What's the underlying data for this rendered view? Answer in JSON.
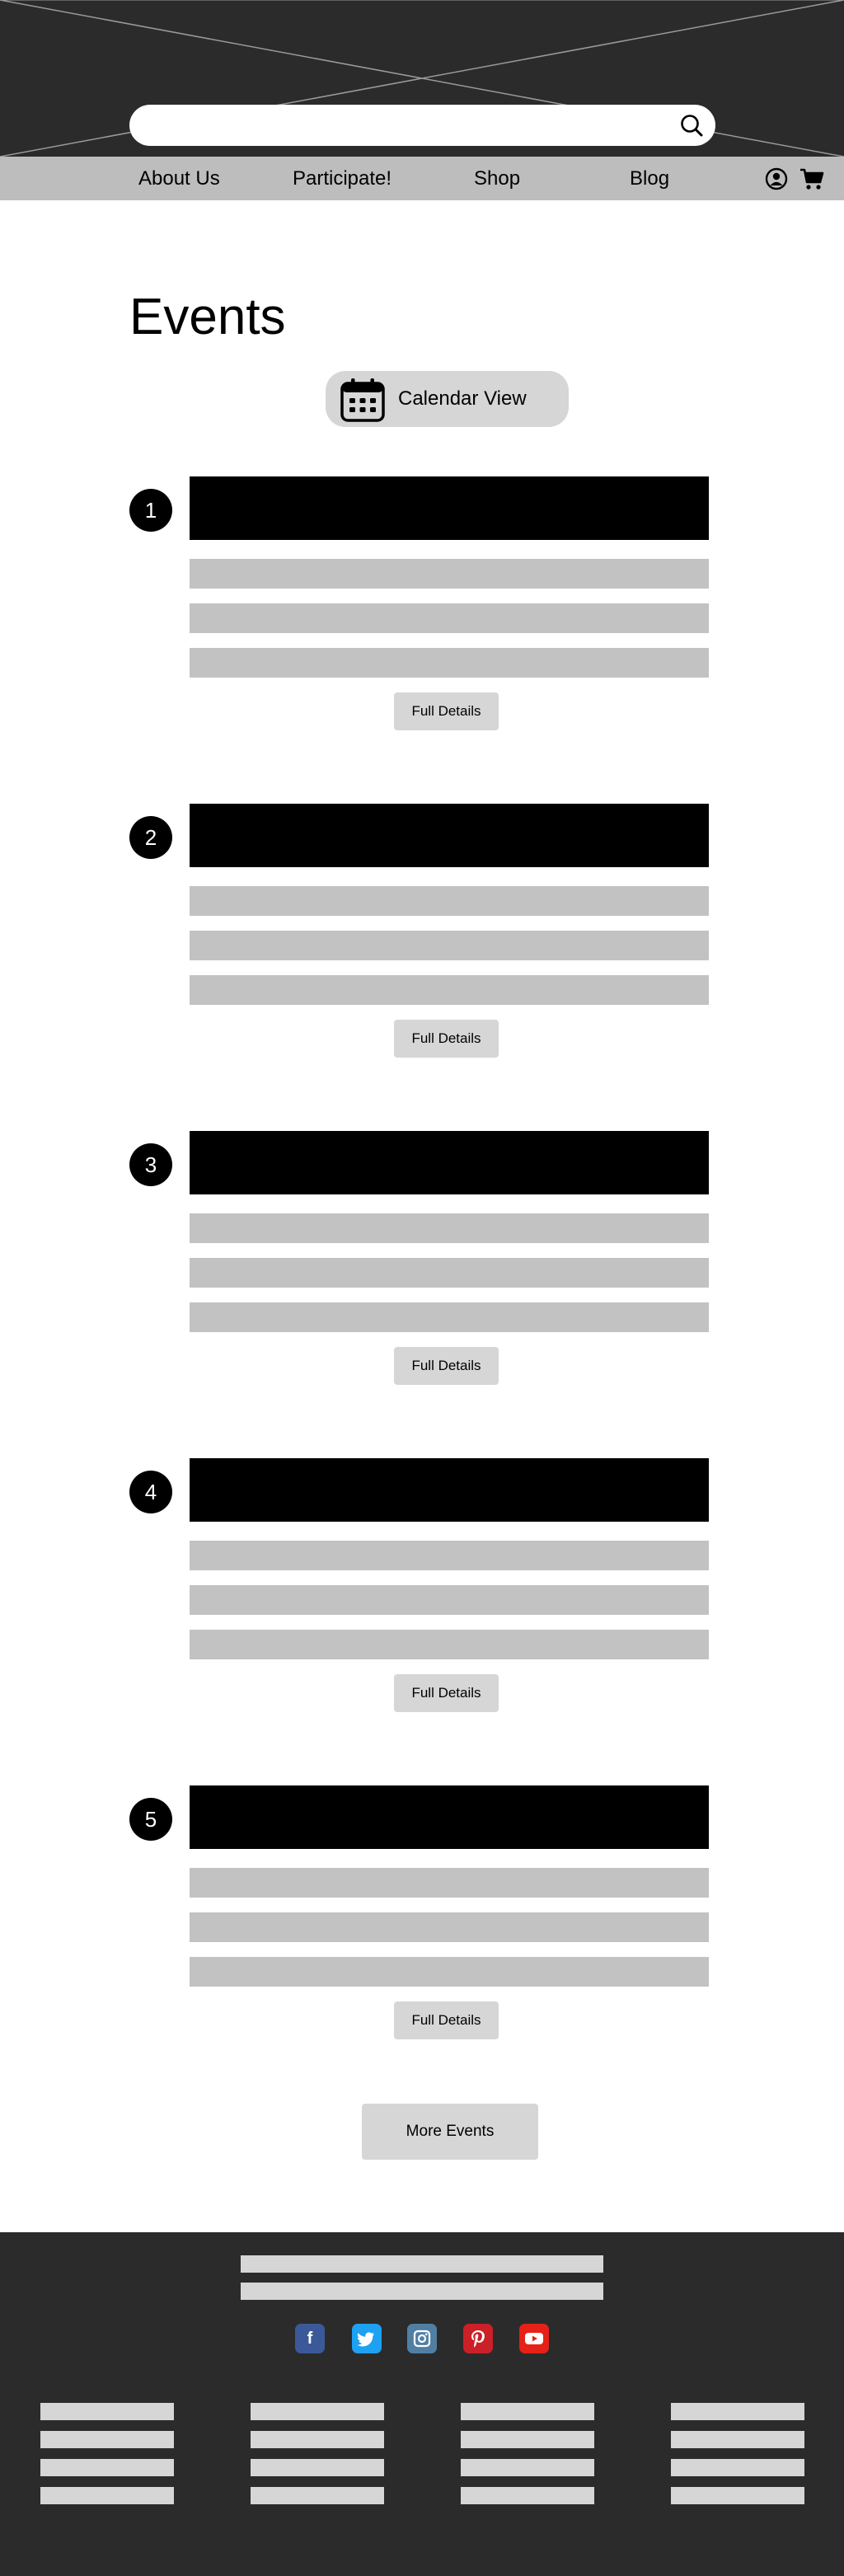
{
  "search": {
    "value": "",
    "placeholder": ""
  },
  "nav": {
    "items": [
      {
        "label": "About Us"
      },
      {
        "label": "Participate!"
      },
      {
        "label": "Shop"
      },
      {
        "label": "Blog"
      }
    ],
    "user_icon": "user-circle-icon",
    "cart_icon": "shopping-cart-icon"
  },
  "main": {
    "title": "Events",
    "calendar_button": {
      "label": "Calendar View",
      "icon": "calendar-icon"
    },
    "events": [
      {
        "number": "1",
        "details_label": "Full Details"
      },
      {
        "number": "2",
        "details_label": "Full Details"
      },
      {
        "number": "3",
        "details_label": "Full Details"
      },
      {
        "number": "4",
        "details_label": "Full Details"
      },
      {
        "number": "5",
        "details_label": "Full Details"
      }
    ],
    "more_events_label": "More Events"
  },
  "footer": {
    "social": [
      {
        "icon": "facebook-icon",
        "color": "#3b5998"
      },
      {
        "icon": "twitter-icon",
        "color": "#1da1f2"
      },
      {
        "icon": "instagram-icon",
        "color": "#517fa4"
      },
      {
        "icon": "pinterest-icon",
        "color": "#cb2027"
      },
      {
        "icon": "youtube-icon",
        "color": "#e62117"
      }
    ]
  },
  "colors": {
    "dark_bg": "#2b2b2b",
    "nav_bg": "#bdbdbd",
    "button_bg": "#d6d6d6",
    "placeholder_line": "#c2c2c2"
  }
}
